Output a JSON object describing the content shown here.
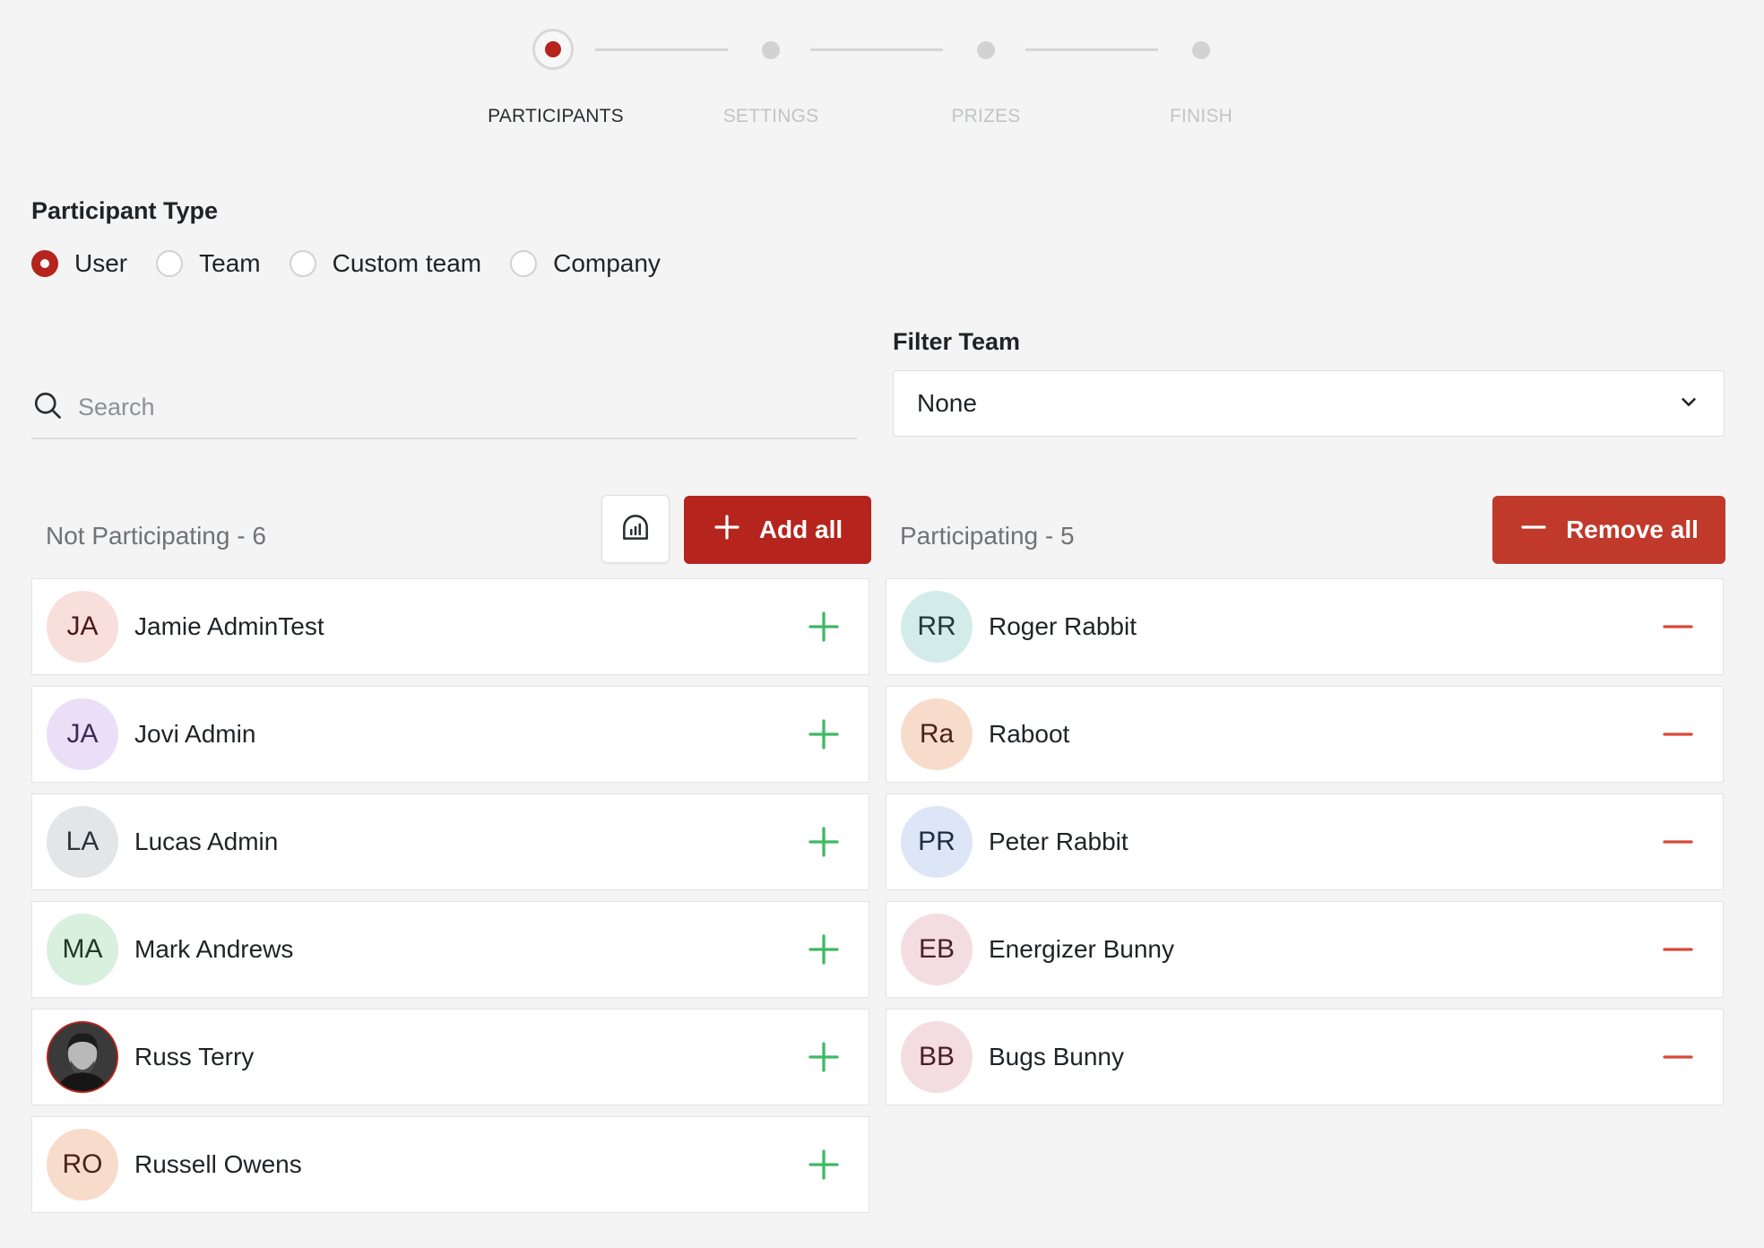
{
  "stepper": {
    "steps": [
      {
        "label": "PARTICIPANTS",
        "active": true
      },
      {
        "label": "SETTINGS",
        "active": false
      },
      {
        "label": "PRIZES",
        "active": false
      },
      {
        "label": "FINISH",
        "active": false
      }
    ]
  },
  "participant_type": {
    "title": "Participant Type",
    "options": [
      "User",
      "Team",
      "Custom team",
      "Company"
    ],
    "selected": "User"
  },
  "search": {
    "placeholder": "Search",
    "value": ""
  },
  "filter": {
    "title": "Filter Team",
    "value": "None"
  },
  "not_participating": {
    "title": "Not Participating - 6",
    "add_all_label": "Add all",
    "items": [
      {
        "initials": "JA",
        "name": "Jamie AdminTest",
        "avatar_bg": "#f8dfdc",
        "avatar_fg": "#4a1a16"
      },
      {
        "initials": "JA",
        "name": "Jovi Admin",
        "avatar_bg": "#eadff7",
        "avatar_fg": "#3c2a55"
      },
      {
        "initials": "LA",
        "name": "Lucas Admin",
        "avatar_bg": "#e2e6e9",
        "avatar_fg": "#2c3338"
      },
      {
        "initials": "MA",
        "name": "Mark Andrews",
        "avatar_bg": "#d8f0dd",
        "avatar_fg": "#1d3b24"
      },
      {
        "initials": "",
        "name": "Russ Terry",
        "photo": true
      },
      {
        "initials": "RO",
        "name": "Russell Owens",
        "avatar_bg": "#f8dccb",
        "avatar_fg": "#4a2414"
      }
    ]
  },
  "participating": {
    "title": "Participating - 5",
    "remove_all_label": "Remove all",
    "items": [
      {
        "initials": "RR",
        "name": "Roger Rabbit",
        "avatar_bg": "#d3ecea",
        "avatar_fg": "#1e3a38"
      },
      {
        "initials": "Ra",
        "name": "Raboot",
        "avatar_bg": "#f8dccb",
        "avatar_fg": "#4a2414"
      },
      {
        "initials": "PR",
        "name": "Peter Rabbit",
        "avatar_bg": "#dce6f7",
        "avatar_fg": "#1f2c44"
      },
      {
        "initials": "EB",
        "name": "Energizer Bunny",
        "avatar_bg": "#f4dde1",
        "avatar_fg": "#4a1e26"
      },
      {
        "initials": "BB",
        "name": "Bugs Bunny",
        "avatar_bg": "#f4dde1",
        "avatar_fg": "#4a1e26"
      }
    ]
  },
  "colors": {
    "accent": "#b5241d",
    "remove_button": "#c1392b",
    "add_icon": "#3fb964",
    "remove_icon": "#d9483b"
  },
  "icons": {
    "search": "search-icon",
    "dropdown": "chevron-down-icon",
    "stats": "bar-chart-icon",
    "add": "plus-icon",
    "remove": "minus-icon"
  }
}
